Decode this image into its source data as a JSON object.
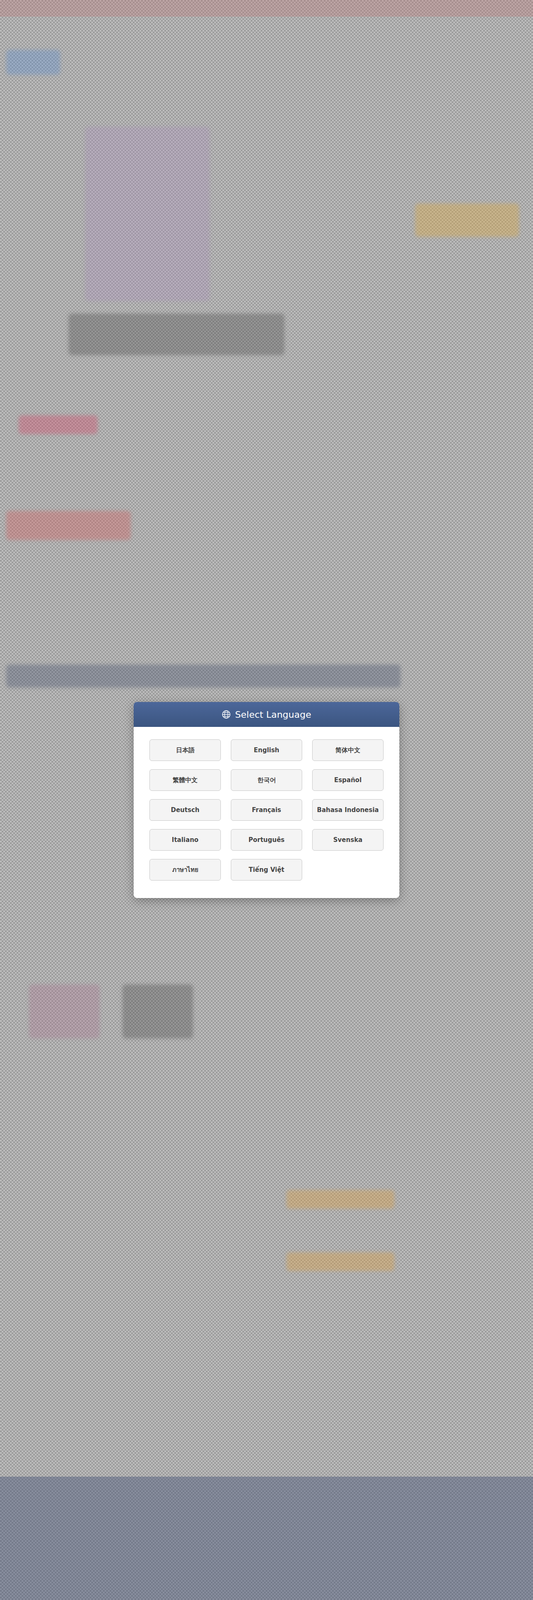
{
  "dialog": {
    "title": "Select Language",
    "languages": [
      {
        "label": "日本語"
      },
      {
        "label": "English"
      },
      {
        "label": "简体中文"
      },
      {
        "label": "繁體中文"
      },
      {
        "label": "한국어"
      },
      {
        "label": "Español"
      },
      {
        "label": "Deutsch"
      },
      {
        "label": "Français"
      },
      {
        "label": "Bahasa Indonesia"
      },
      {
        "label": "Italiano"
      },
      {
        "label": "Português"
      },
      {
        "label": "Svenska"
      },
      {
        "label": "ภาษาไทย"
      },
      {
        "label": "Tiếng Việt"
      }
    ]
  }
}
